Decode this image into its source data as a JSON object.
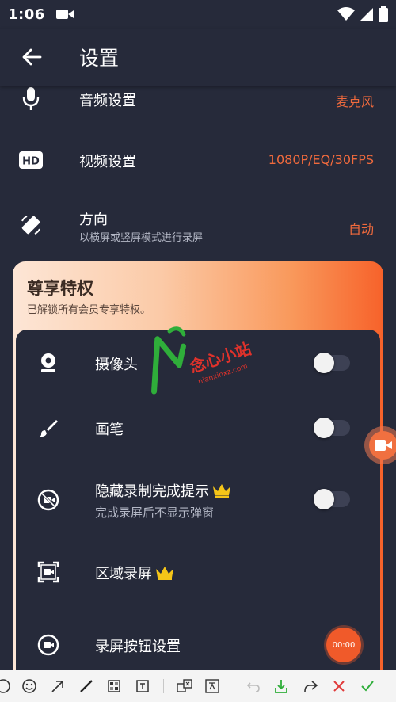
{
  "status_bar": {
    "time": "1:06"
  },
  "app_bar": {
    "title": "设置"
  },
  "settings": {
    "audio": {
      "title": "音频设置",
      "value": "麦克风"
    },
    "video": {
      "title": "视频设置",
      "value": "1080P/EQ/30FPS"
    },
    "orientation": {
      "title": "方向",
      "subtitle": "以横屏或竖屏模式进行录屏",
      "value": "自动"
    }
  },
  "premium": {
    "title": "尊享特权",
    "subtitle": "已解锁所有会员专享特权。",
    "items": [
      {
        "title": "摄像头",
        "toggle": false
      },
      {
        "title": "画笔",
        "toggle": false
      },
      {
        "title": "隐藏录制完成提示",
        "subtitle": "完成录屏后不显示弹窗",
        "toggle": false,
        "crown": true
      },
      {
        "title": "区域录屏",
        "crown": true
      },
      {
        "title": "录屏按钮设置"
      }
    ]
  },
  "floating": {
    "timer": "00:00"
  },
  "watermark": {
    "text": "念心小站",
    "url": "nianxinxz.com"
  },
  "colors": {
    "accent": "#f06a3d",
    "background": "#262a3a",
    "crown": "#f5c518",
    "watermark_green": "#2fae3a",
    "watermark_red": "#e0322b"
  }
}
